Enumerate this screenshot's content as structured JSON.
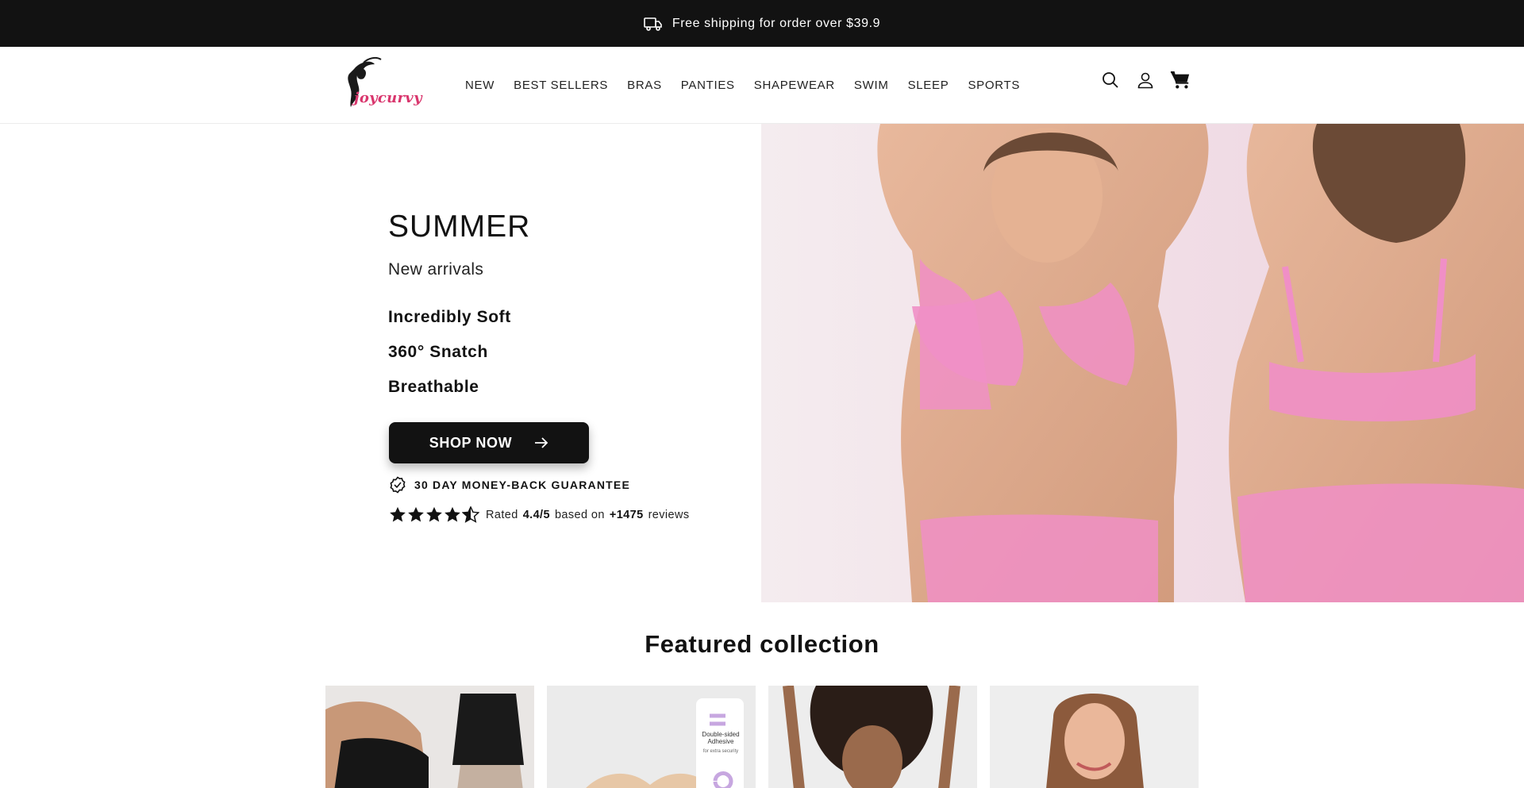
{
  "announcement": {
    "text": "Free shipping for order over $39.9",
    "icon": "truck-icon"
  },
  "header": {
    "logo_text": "joycurvy",
    "nav": [
      {
        "label": "NEW"
      },
      {
        "label": "BEST SELLERS"
      },
      {
        "label": "BRAS"
      },
      {
        "label": "PANTIES"
      },
      {
        "label": "SHAPEWEAR"
      },
      {
        "label": "SWIM"
      },
      {
        "label": "SLEEP"
      },
      {
        "label": "SPORTS"
      }
    ],
    "icons": [
      "search-icon",
      "account-icon",
      "cart-icon"
    ]
  },
  "hero": {
    "title": "SUMMER",
    "subtitle": "New arrivals",
    "features": [
      "Incredibly Soft",
      "360° Snatch",
      "Breathable"
    ],
    "cta_label": "SHOP NOW",
    "guarantee": "30 DAY MONEY-BACK GUARANTEE",
    "rating": {
      "prefix": "Rated",
      "score": "4.4/5",
      "middle": "based on",
      "count": "+1475",
      "suffix": "reviews",
      "stars": 4.5
    }
  },
  "featured": {
    "title": "Featured collection",
    "badge_text": "Double-sided Adhesive",
    "badge_sub": "for extra security"
  },
  "colors": {
    "dark": "#121212",
    "brand_pink": "#d9366d",
    "bra_pink": "#f08fc6"
  }
}
